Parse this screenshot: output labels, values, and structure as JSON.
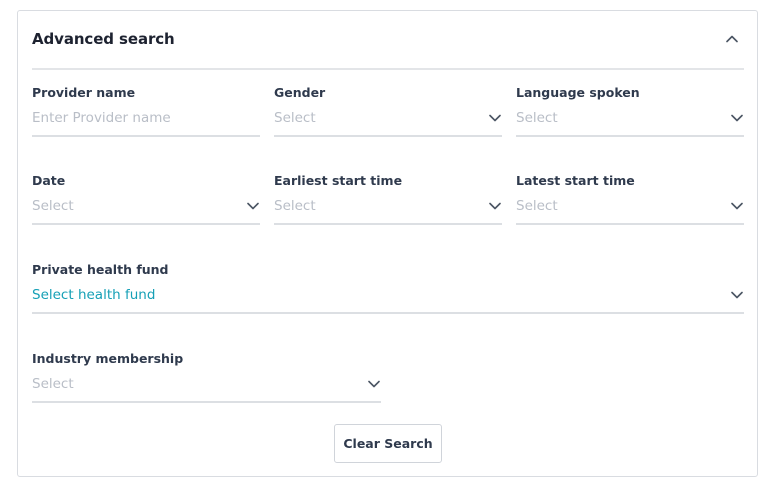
{
  "header": {
    "title": "Advanced search"
  },
  "fields": {
    "provider_name": {
      "label": "Provider name",
      "placeholder": "Enter Provider name"
    },
    "gender": {
      "label": "Gender",
      "value": "Select"
    },
    "language": {
      "label": "Language spoken",
      "value": "Select"
    },
    "date": {
      "label": "Date",
      "value": "Select"
    },
    "earliest_start": {
      "label": "Earliest start time",
      "value": "Select"
    },
    "latest_start": {
      "label": "Latest start time",
      "value": "Select"
    },
    "health_fund": {
      "label": "Private health fund",
      "value": "Select health fund"
    },
    "membership": {
      "label": "Industry membership",
      "value": "Select"
    }
  },
  "actions": {
    "clear_label": "Clear Search"
  },
  "colors": {
    "accent": "#16a0b6",
    "placeholder": "#b9bec7",
    "label": "#2f3a4d",
    "divider": "#dcdfe3"
  },
  "icons": {
    "collapse": "chevron-up-icon",
    "dropdown": "chevron-down-icon"
  }
}
